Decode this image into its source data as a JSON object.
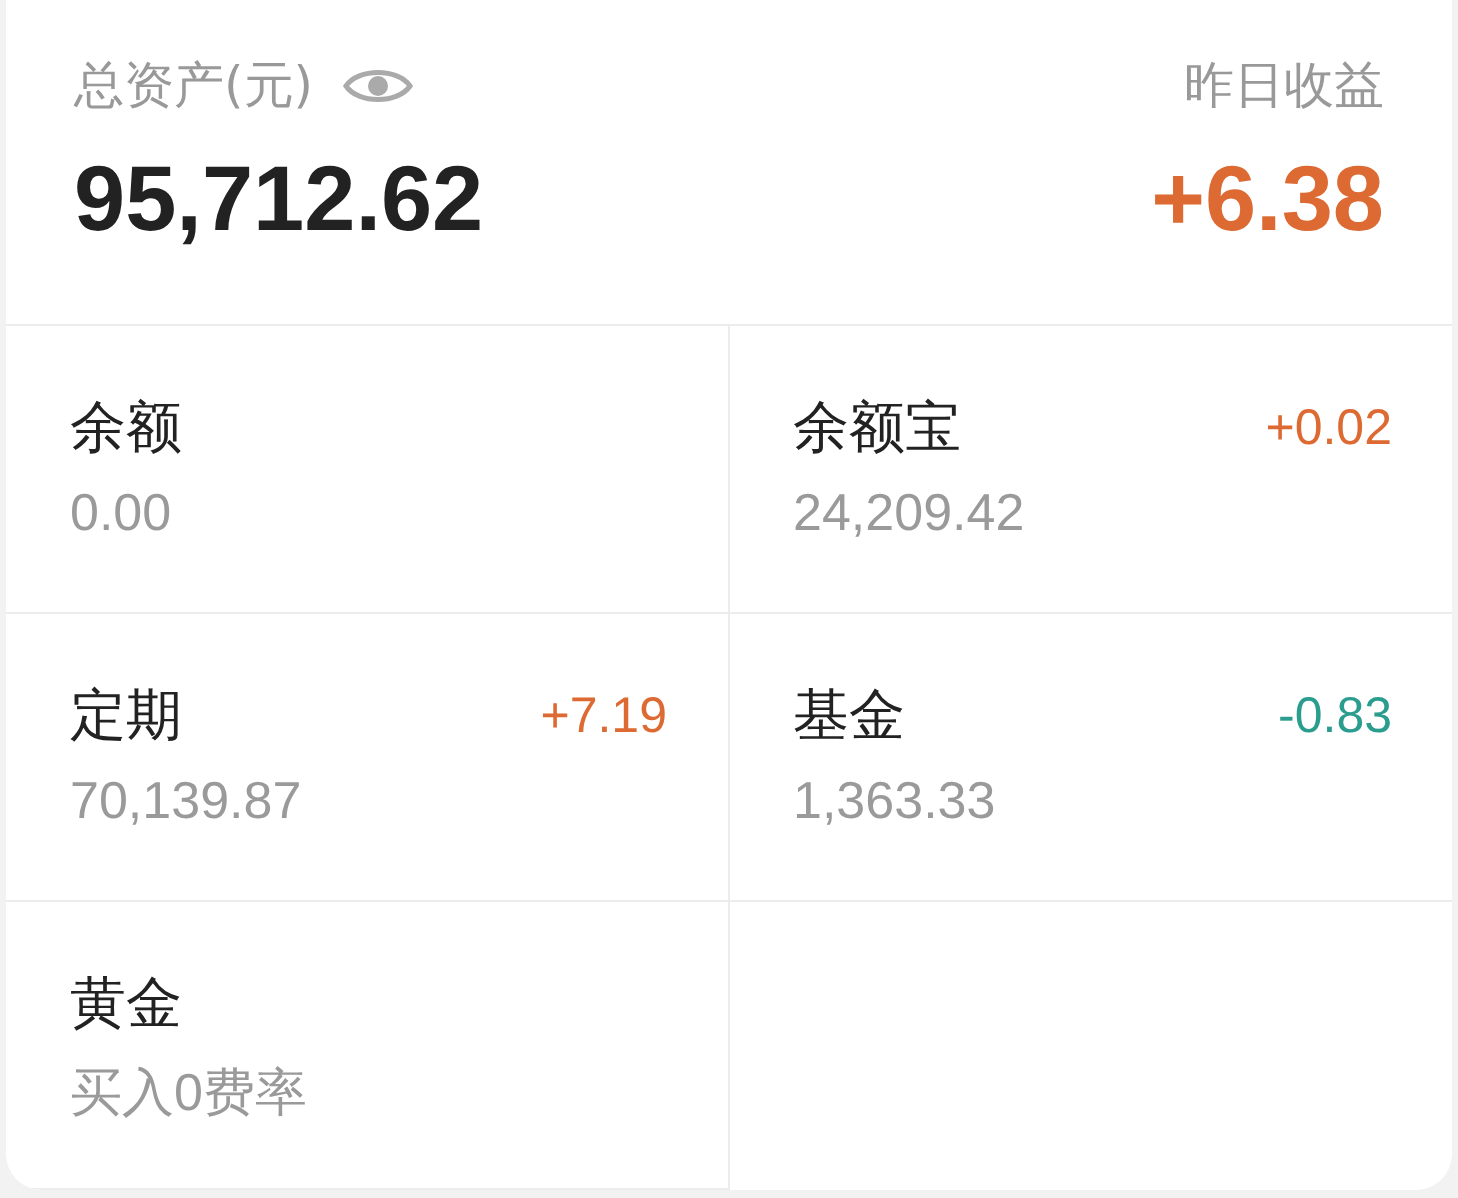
{
  "summary": {
    "label": "总资产(元)",
    "total": "95,712.62",
    "yesterday_label": "昨日收益",
    "yesterday_value": "+6.38"
  },
  "assets": [
    {
      "name": "余额",
      "value": "0.00"
    },
    {
      "name": "余额宝",
      "value": "24,209.42",
      "change": "+0.02",
      "color": "#dd6a32"
    },
    {
      "name": "定期",
      "value": "70,139.87",
      "change": "+7.19",
      "color": "#dd6a32"
    },
    {
      "name": "基金",
      "value": "1,363.33",
      "change": "-0.83",
      "color": "#2a9d8f"
    },
    {
      "name": "黄金",
      "value": "买入0费率"
    }
  ]
}
